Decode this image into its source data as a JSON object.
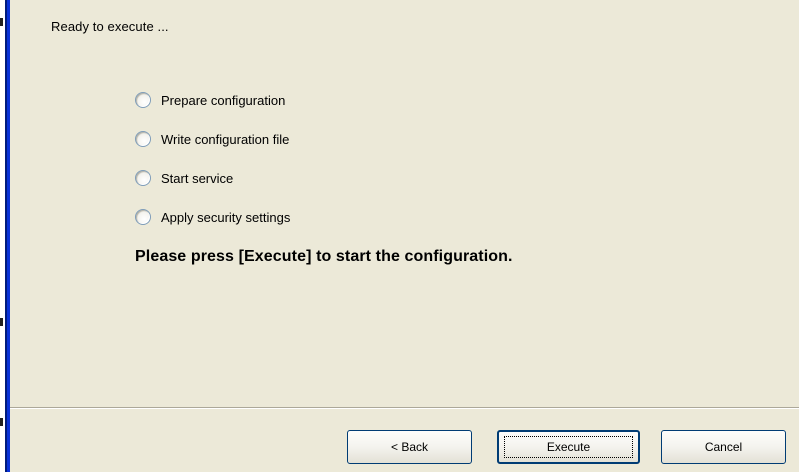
{
  "header": {
    "status": "Ready to execute ..."
  },
  "steps": [
    {
      "label": "Prepare configuration",
      "icon": "radio-empty-icon"
    },
    {
      "label": "Write configuration file",
      "icon": "radio-empty-icon"
    },
    {
      "label": "Start service",
      "icon": "radio-empty-icon"
    },
    {
      "label": "Apply security settings",
      "icon": "radio-empty-icon"
    }
  ],
  "instruction": "Please press [Execute] to start the configuration.",
  "buttons": {
    "back": "< Back",
    "execute": "Execute",
    "cancel": "Cancel"
  },
  "colors": {
    "dialog_background": "#ece9d8",
    "frame_accent": "#0831d9",
    "button_border": "#003c74"
  }
}
